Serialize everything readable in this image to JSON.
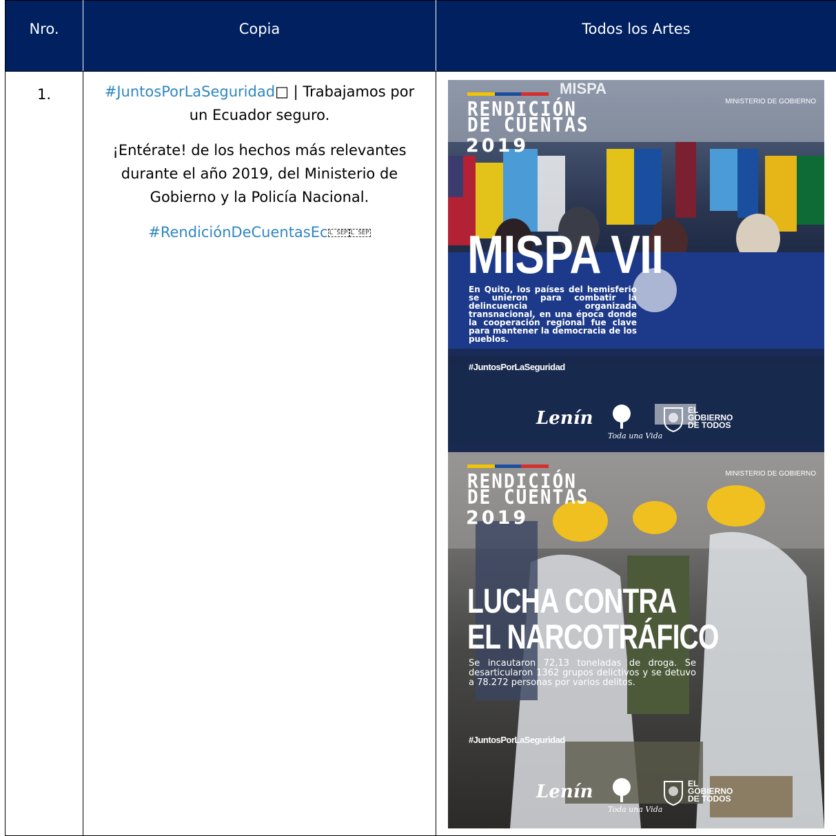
{
  "table": {
    "headers": [
      "Nro.",
      "Copia",
      "Todos los Artes"
    ],
    "header_bg": "#002060",
    "rows": [
      {
        "nro": "1.",
        "copia": {
          "line1_hashtag": "#JuntosPorLaSeguridad",
          "line1_glyph": "□",
          "line1_rest": " | Trabajamos por un Ecuador seguro.",
          "paragraph2": "¡Entérate! de los hechos más relevantes durante el año 2019, del Ministerio de Gobierno y la Policía Nacional.",
          "hashtag2": "#RendiciónDeCuentasEc",
          "sep_marks": [
            "L SEP",
            "L SEP"
          ]
        }
      }
    ]
  },
  "artes": [
    {
      "stripe_colors": [
        "#f2c500",
        "#1a4fa0",
        "#d62d2d"
      ],
      "title_lines": [
        "RENDICIÓN",
        "DE CUENTAS"
      ],
      "year": "2019",
      "ministerio": "MINISTERIO DE GOBIERNO",
      "event_logo": "MISPA",
      "headline": "MISPA VII",
      "body": "En Quito, los países del hemisferio se unieron para combatir la delincuencia organizada transnacional, en una época donde la cooperación regional fue clave para mantener la democracia de los pueblos.",
      "hashtag": "#JuntosPorLaSeguridad",
      "signature": "Lenín",
      "tree_label": "Toda una Vida",
      "gobierno_lines": [
        "EL",
        "GOBIERNO",
        "DE TODOS"
      ]
    },
    {
      "stripe_colors": [
        "#f2c500",
        "#1a4fa0",
        "#d62d2d"
      ],
      "title_lines": [
        "RENDICIÓN",
        "DE CUENTAS"
      ],
      "year": "2019",
      "ministerio": "MINISTERIO DE GOBIERNO",
      "headline_lines": [
        "LUCHA CONTRA",
        "EL NARCOTRÁFICO"
      ],
      "body": "Se incautaron 72,13 toneladas de droga. Se desarticularon 1362 grupos delictivos y se detuvo a 78.272 personas por varios delitos.",
      "hashtag": "#JuntosPorLaSeguridad",
      "signature": "Lenín",
      "tree_label": "Toda una Vida",
      "gobierno_lines": [
        "EL",
        "GOBIERNO",
        "DE TODOS"
      ]
    }
  ],
  "colors": {
    "hashtag": "#2e86c1",
    "header_bg": "#002060"
  }
}
